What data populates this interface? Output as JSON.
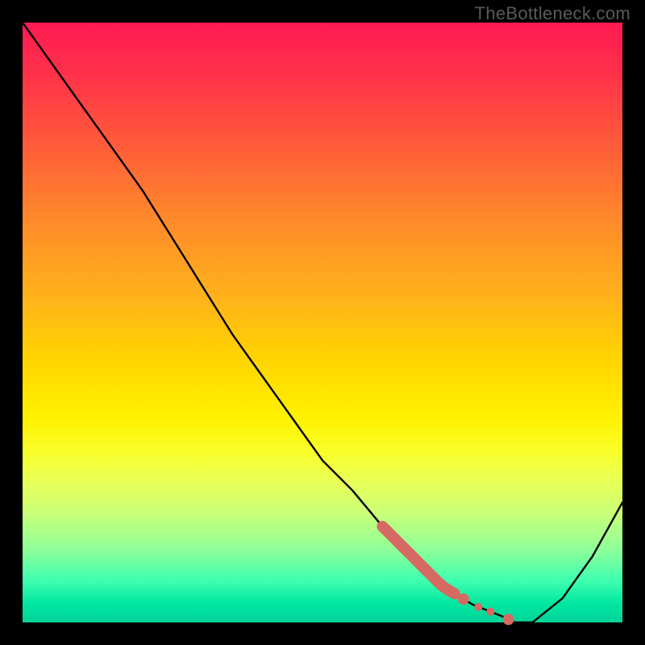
{
  "watermark": "TheBottleneck.com",
  "colors": {
    "curve": "#000000",
    "highlight": "#d66a63",
    "background": "#000000"
  },
  "chart_data": {
    "type": "line",
    "title": "",
    "xlabel": "",
    "ylabel": "",
    "xlim": [
      0,
      100
    ],
    "ylim": [
      0,
      100
    ],
    "grid": false,
    "x": [
      0,
      5,
      10,
      15,
      20,
      25,
      30,
      35,
      40,
      45,
      50,
      55,
      60,
      65,
      70,
      75,
      80,
      82,
      85,
      90,
      95,
      100
    ],
    "values": [
      100,
      93,
      86,
      79,
      72,
      64,
      56,
      48,
      41,
      34,
      27,
      22,
      16,
      11,
      6,
      3,
      1,
      0,
      0,
      4,
      11,
      20
    ],
    "highlight_segment": {
      "x_start": 60,
      "x_end": 72
    },
    "highlight_dots_x": [
      73.5,
      76,
      78,
      81
    ],
    "annotations": []
  }
}
